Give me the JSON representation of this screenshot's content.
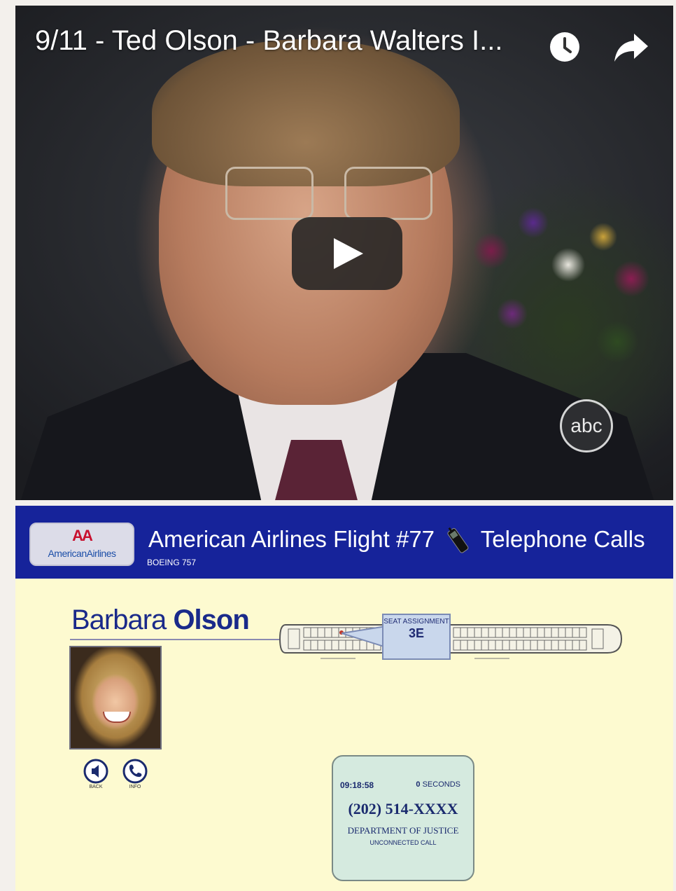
{
  "video": {
    "title": "9/11 - Ted Olson - Barbara Walters I...",
    "watermark": "abc",
    "icons": [
      "clock-icon",
      "share-icon",
      "play-icon"
    ]
  },
  "panel": {
    "logo_mark": "AA",
    "logo_word": "AmericanAirlines",
    "title_before": "American Airlines Flight #77",
    "title_after": "Telephone Calls",
    "subtitle": "BOEING 757",
    "person_first": "Barbara",
    "person_last": "Olson",
    "buttons": [
      {
        "label": "BACK",
        "icon": "speaker-icon"
      },
      {
        "label": "INFO",
        "icon": "phone-icon"
      }
    ],
    "seat": {
      "label": "SEAT ASSIGNMENT",
      "number": "3E"
    },
    "call": {
      "time": "09:18:58",
      "duration_value": "0",
      "duration_unit": "SECONDS",
      "phone": "(202) 514-XXXX",
      "department": "DEPARTMENT OF JUSTICE",
      "status": "UNCONNECTED CALL"
    },
    "colors": {
      "banner": "#16239a",
      "panel_bg": "#fdfad0",
      "card_bg": "#d5eadf"
    }
  }
}
